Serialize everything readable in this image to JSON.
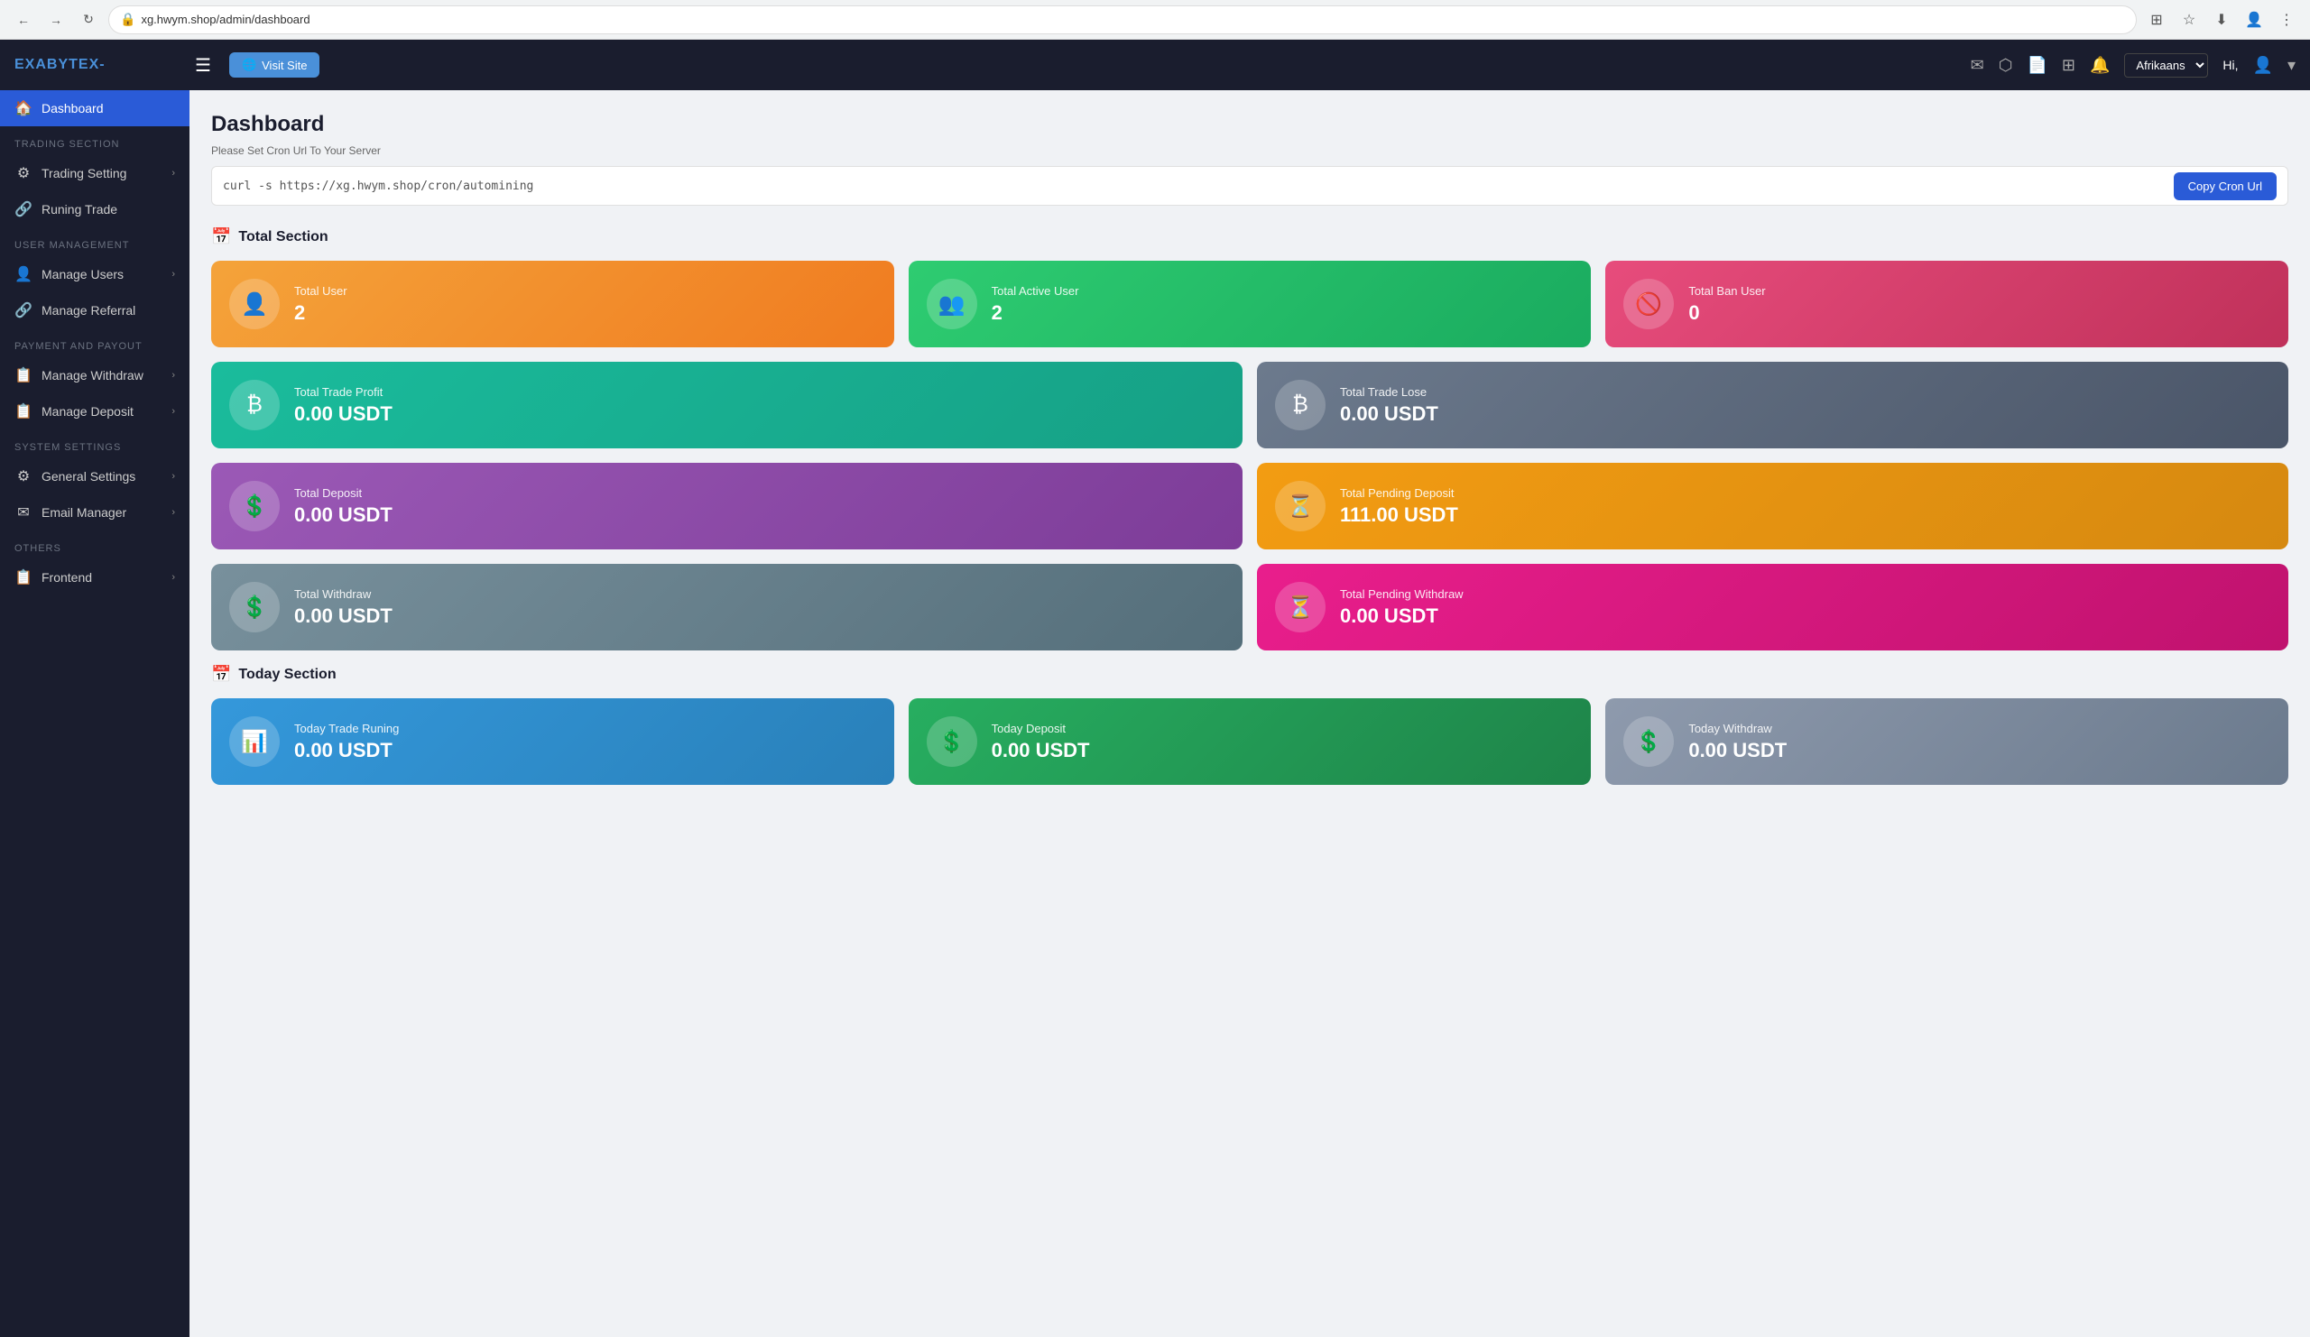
{
  "browser": {
    "url": "xg.hwym.shop/admin/dashboard",
    "back_title": "Back",
    "forward_title": "Forward",
    "refresh_title": "Refresh"
  },
  "topnav": {
    "logo": "EXABYTEX-",
    "visit_site_label": "Visit Site",
    "language": "Afrikaans",
    "hi_label": "Hi,",
    "hamburger_icon": "☰"
  },
  "sidebar": {
    "dashboard_label": "Dashboard",
    "sections": [
      {
        "title": "TRADING SECTION",
        "items": [
          {
            "label": "Trading Setting",
            "icon": "⚙",
            "arrow": true
          },
          {
            "label": "Runing Trade",
            "icon": "🔗",
            "arrow": false
          }
        ]
      },
      {
        "title": "USER MANAGEMENT",
        "items": [
          {
            "label": "Manage Users",
            "icon": "👤",
            "arrow": true
          },
          {
            "label": "Manage Referral",
            "icon": "🔗",
            "arrow": false
          }
        ]
      },
      {
        "title": "PAYMENT AND PAYOUT",
        "items": [
          {
            "label": "Manage Withdraw",
            "icon": "📋",
            "arrow": true
          },
          {
            "label": "Manage Deposit",
            "icon": "📋",
            "arrow": true
          }
        ]
      },
      {
        "title": "SYSTEM SETTINGS",
        "items": [
          {
            "label": "General Settings",
            "icon": "⚙",
            "arrow": true
          },
          {
            "label": "Email Manager",
            "icon": "✉",
            "arrow": true
          }
        ]
      },
      {
        "title": "OTHERS",
        "items": [
          {
            "label": "Frontend",
            "icon": "📋",
            "arrow": true
          }
        ]
      }
    ]
  },
  "dashboard": {
    "title": "Dashboard",
    "cron_notice": "Please Set Cron Url To Your Server",
    "cron_url": "curl -s https://xg.hwym.shop/cron/automining",
    "copy_cron_label": "Copy Cron Url"
  },
  "total_section": {
    "title": "Total Section",
    "cards": [
      {
        "label": "Total User",
        "value": "2",
        "color": "card-orange",
        "icon": "👤"
      },
      {
        "label": "Total Active User",
        "value": "2",
        "color": "card-green",
        "icon": "👥"
      },
      {
        "label": "Total Ban User",
        "value": "0",
        "color": "card-red",
        "icon": "🚫"
      },
      {
        "label": "Total Trade Profit",
        "value": "0.00 USDT",
        "color": "card-teal",
        "icon": "₿"
      },
      {
        "label": "Total Trade Lose",
        "value": "0.00 USDT",
        "color": "card-slate",
        "icon": "₿"
      },
      {
        "label": "Total Deposit",
        "value": "0.00 USDT",
        "color": "card-purple",
        "icon": "💲"
      },
      {
        "label": "Total Pending Deposit",
        "value": "111.00 USDT",
        "color": "card-orange2",
        "icon": "⏳"
      },
      {
        "label": "Total Withdraw",
        "value": "0.00 USDT",
        "color": "card-grey",
        "icon": "💲"
      },
      {
        "label": "Total Pending Withdraw",
        "value": "0.00 USDT",
        "color": "card-pink",
        "icon": "⏳"
      }
    ]
  },
  "today_section": {
    "title": "Today Section",
    "cards": [
      {
        "label": "Today Trade Runing",
        "value": "0.00 USDT",
        "color": "card-blue",
        "icon": "📊"
      },
      {
        "label": "Today Deposit",
        "value": "0.00 USDT",
        "color": "card-green2",
        "icon": "💲"
      },
      {
        "label": "Today Withdraw",
        "value": "0.00 USDT",
        "color": "card-grey2",
        "icon": "💲"
      }
    ]
  }
}
